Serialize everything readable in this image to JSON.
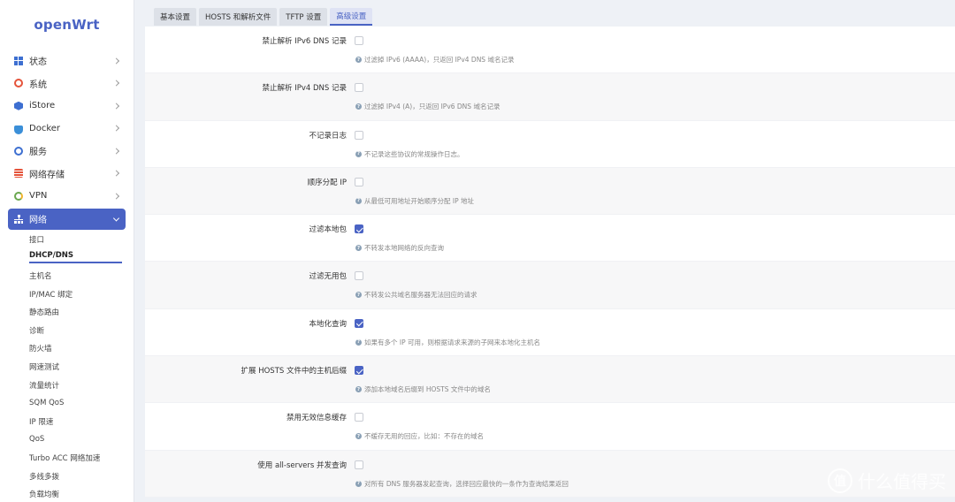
{
  "brand": "openWrt",
  "sidebar": {
    "items": [
      {
        "label": "状态",
        "icon": "status-icon"
      },
      {
        "label": "系统",
        "icon": "gear-icon"
      },
      {
        "label": "iStore",
        "icon": "istore-icon"
      },
      {
        "label": "Docker",
        "icon": "docker-icon"
      },
      {
        "label": "服务",
        "icon": "service-icon"
      },
      {
        "label": "网络存储",
        "icon": "storage-icon"
      },
      {
        "label": "VPN",
        "icon": "vpn-icon"
      },
      {
        "label": "网络",
        "icon": "network-icon"
      }
    ],
    "submenu": [
      "接口",
      "DHCP/DNS",
      "主机名",
      "IP/MAC 绑定",
      "静态路由",
      "诊断",
      "防火墙",
      "网速测试",
      "流量统计",
      "SQM QoS",
      "IP 限速",
      "QoS",
      "Turbo ACC 网络加速",
      "多线多拨",
      "负载均衡"
    ]
  },
  "tabs": [
    "基本设置",
    "HOSTS 和解析文件",
    "TFTP 设置",
    "高级设置"
  ],
  "rows": [
    {
      "label": "禁止解析 IPv6 DNS 记录",
      "checked": false,
      "hint": "过滤掉 IPv6 (AAAA)，只返回 IPv4 DNS 域名记录"
    },
    {
      "label": "禁止解析 IPv4 DNS 记录",
      "checked": false,
      "hint": "过滤掉 IPv4 (A)，只返回 IPv6 DNS 域名记录"
    },
    {
      "label": "不记录日志",
      "checked": false,
      "hint": "不记录这些协议的常规操作日志。"
    },
    {
      "label": "顺序分配 IP",
      "checked": false,
      "hint": "从最低可用地址开始顺序分配 IP 地址"
    },
    {
      "label": "过滤本地包",
      "checked": true,
      "hint": "不转发本地网络的反向查询"
    },
    {
      "label": "过滤无用包",
      "checked": false,
      "hint": "不转发公共域名服务器无法回应的请求"
    },
    {
      "label": "本地化查询",
      "checked": true,
      "hint": "如果有多个 IP 可用，则根据请求来源的子网来本地化主机名"
    },
    {
      "label": "扩展 HOSTS 文件中的主机后缀",
      "checked": true,
      "hint": "添加本地域名后缀到 HOSTS 文件中的域名"
    },
    {
      "label": "禁用无效信息缓存",
      "checked": false,
      "hint": "不缓存无用的回应，比如：不存在的域名"
    },
    {
      "label": "使用 all-servers 并发查询",
      "checked": false,
      "hint": "对所有 DNS 服务器发起查询，选择回应最快的一条作为查询结果返回"
    }
  ],
  "watermark": {
    "icon_text": "值",
    "text": "什么值得买"
  }
}
